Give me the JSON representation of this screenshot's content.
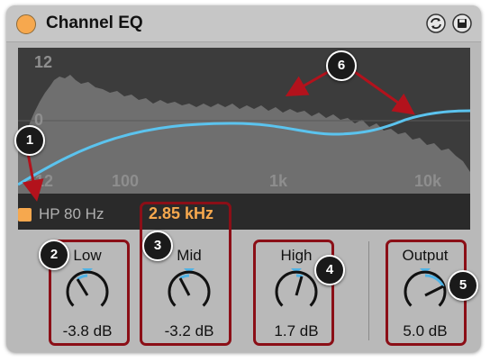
{
  "header": {
    "title": "Channel EQ",
    "power_icon": "power-toggle-icon",
    "hot_swap_icon": "hot-swap-icon",
    "save_icon": "save-preset-icon"
  },
  "display": {
    "y_labels": [
      "12",
      "0",
      "-12"
    ],
    "x_labels": [
      "100",
      "1k",
      "10k"
    ]
  },
  "filter_strip": {
    "hp_label": "HP 80 Hz",
    "mid_freq": "2.85 kHz"
  },
  "knobs": {
    "low": {
      "label": "Low",
      "value": "-3.8 dB"
    },
    "mid": {
      "label": "Mid",
      "value": "-3.2 dB"
    },
    "high": {
      "label": "High",
      "value": "1.7 dB"
    },
    "output": {
      "label": "Output",
      "value": "5.0 dB"
    }
  },
  "callouts": [
    "1",
    "2",
    "3",
    "4",
    "5",
    "6"
  ],
  "colors": {
    "accent_orange": "#f6a84e",
    "eq_curve": "#5bc3ee",
    "knob_indicator": "#4fb3e6",
    "callout_red": "#8b0f17"
  }
}
